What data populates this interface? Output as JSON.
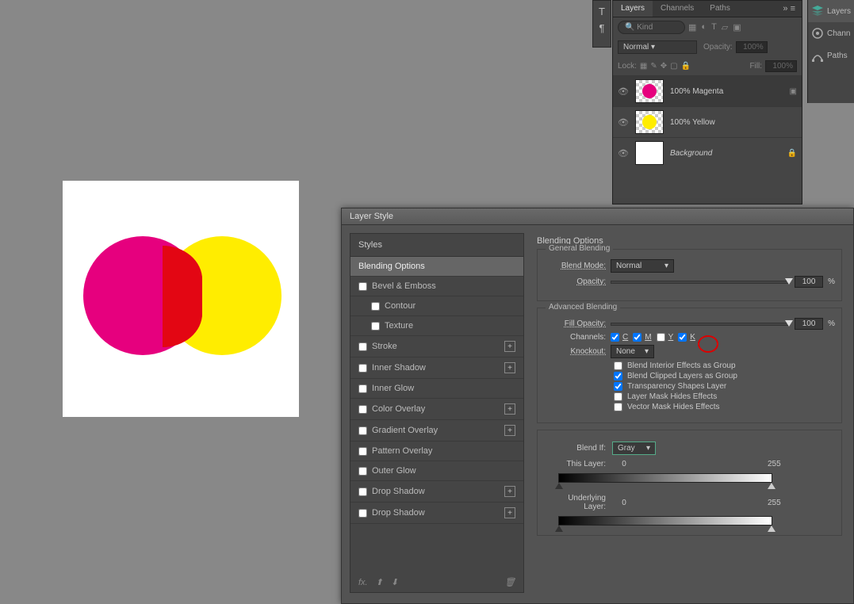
{
  "canvas": {},
  "layers_panel": {
    "tabs": [
      "Layers",
      "Channels",
      "Paths"
    ],
    "kind": "Kind",
    "blend_mode": "Normal",
    "opacity_label": "Opacity:",
    "opacity_value": "100%",
    "lock_label": "Lock:",
    "fill_label": "Fill:",
    "fill_value": "100%",
    "layers": [
      {
        "name": "100% Magenta",
        "color": "#e6007e",
        "selected": true,
        "italic": false
      },
      {
        "name": "100% Yellow",
        "color": "#ffed00",
        "selected": false,
        "italic": false
      },
      {
        "name": "Background",
        "color": "#ffffff",
        "selected": false,
        "italic": true,
        "locked": true
      }
    ]
  },
  "right_dock": {
    "items": [
      "Layers",
      "Chann",
      "Paths"
    ]
  },
  "dialog": {
    "title": "Layer Style",
    "styles_header": "Styles",
    "styles": [
      {
        "label": "Blending Options",
        "selected": true,
        "checkbox": false
      },
      {
        "label": "Bevel & Emboss",
        "checkbox": true
      },
      {
        "label": "Contour",
        "checkbox": true,
        "sub": true
      },
      {
        "label": "Texture",
        "checkbox": true,
        "sub": true
      },
      {
        "label": "Stroke",
        "checkbox": true,
        "plus": true
      },
      {
        "label": "Inner Shadow",
        "checkbox": true,
        "plus": true
      },
      {
        "label": "Inner Glow",
        "checkbox": true
      },
      {
        "label": "Color Overlay",
        "checkbox": true,
        "plus": true
      },
      {
        "label": "Gradient Overlay",
        "checkbox": true,
        "plus": true
      },
      {
        "label": "Pattern Overlay",
        "checkbox": true
      },
      {
        "label": "Outer Glow",
        "checkbox": true
      },
      {
        "label": "Drop Shadow",
        "checkbox": true,
        "plus": true
      },
      {
        "label": "Drop Shadow",
        "checkbox": true,
        "plus": true
      }
    ],
    "section_title": "Blending Options",
    "general": {
      "legend": "General Blending",
      "mode_label": "Blend Mode:",
      "mode_value": "Normal",
      "opacity_label": "Opacity:",
      "opacity_value": "100",
      "pct": "%"
    },
    "advanced": {
      "legend": "Advanced Blending",
      "fill_label": "Fill Opacity:",
      "fill_value": "100",
      "pct": "%",
      "channels_label": "Channels:",
      "channels": {
        "c": "C",
        "m": "M",
        "y": "Y",
        "k": "K"
      },
      "knockout_label": "Knockout:",
      "knockout_value": "None",
      "cb1": "Blend Interior Effects as Group",
      "cb2": "Blend Clipped Layers as Group",
      "cb3": "Transparency Shapes Layer",
      "cb4": "Layer Mask Hides Effects",
      "cb5": "Vector Mask Hides Effects"
    },
    "blendif": {
      "label": "Blend If:",
      "value": "Gray",
      "this_layer": "This Layer:",
      "underlying": "Underlying Layer:",
      "low": "0",
      "high": "255"
    }
  }
}
